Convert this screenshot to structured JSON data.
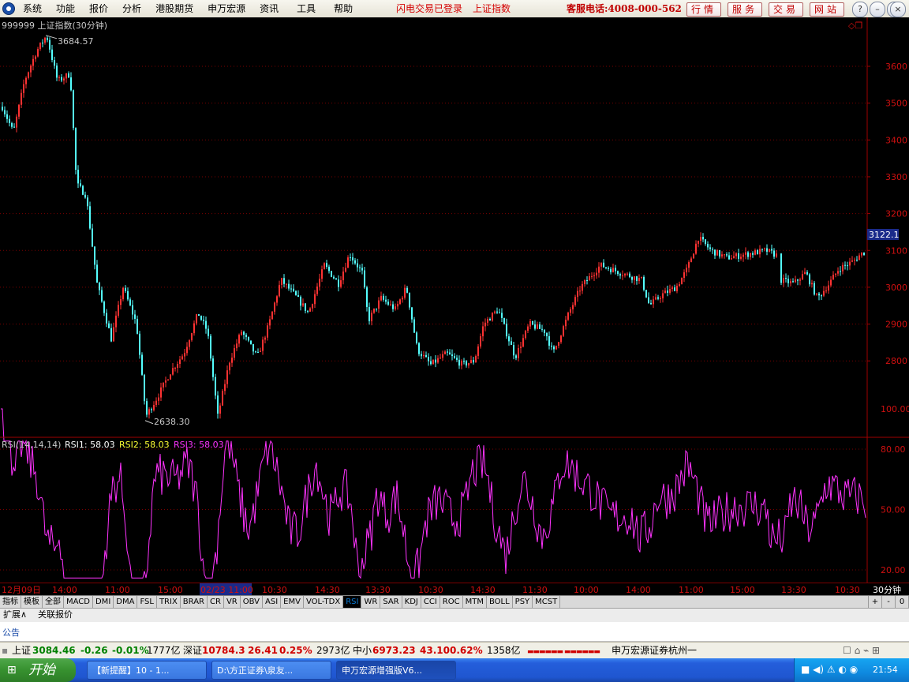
{
  "menu": [
    "系统",
    "功能",
    "报价",
    "分析",
    "港股期货",
    "申万宏源",
    "资讯",
    "工具",
    "帮助"
  ],
  "status": {
    "login": "闪电交易已登录",
    "index": "上证指数"
  },
  "hotline": "客服电话:4008-000-562",
  "nav_buttons": [
    "行情",
    "服务",
    "交易",
    "网站"
  ],
  "chart": {
    "title": "999999 上证指数(30分钟)",
    "price_axis": [
      "3600",
      "3500",
      "3400",
      "3300",
      "3200",
      "3100",
      "3000",
      "2900",
      "2800"
    ],
    "current_price": "3122.1",
    "high_label": "3684.57",
    "low_label": "2638.30",
    "indicator_title": "RSI(14,14,14)",
    "rsi1_label": "RSI1: 58.03",
    "rsi2_label": "RSI2: 58.03",
    "rsi3_label": "RSI3: 58.03",
    "rsi_axis": [
      "100.00",
      "80.00",
      "50.00",
      "20.00"
    ]
  },
  "time_axis": [
    "12月09日",
    "14:00",
    "11:00",
    "15:00",
    "02/23 11:00",
    "10:30",
    "14:30",
    "13:30",
    "10:30",
    "14:30",
    "11:30",
    "10:00",
    "14:00",
    "11:00",
    "15:00",
    "13:30",
    "10:30"
  ],
  "period": "30分钟",
  "indicator_tabs": [
    "指标",
    "模板",
    "全部",
    "MACD",
    "DMI",
    "DMA",
    "FSL",
    "TRIX",
    "BRAR",
    "CR",
    "VR",
    "OBV",
    "ASI",
    "EMV",
    "VOL-TDX",
    "RSI",
    "WR",
    "SAR",
    "KDJ",
    "CCI",
    "ROC",
    "MTM",
    "BOLL",
    "PSY",
    "MCST"
  ],
  "zoom_controls": [
    "+",
    "-",
    "0"
  ],
  "lower_tabs": [
    "扩展∧",
    "关联报价"
  ],
  "notice": "公告",
  "indices": {
    "sh_name": "上证",
    "sh_value": "3084.46",
    "sh_change": "-0.26",
    "sh_pct": "-0.01%",
    "sh_amount": "1777亿",
    "sz_name": "深证",
    "sz_value": "10784.3",
    "sz_change": "26.41",
    "sz_pct": "0.25%",
    "sz_amount": "2973亿",
    "zx_name": "中小",
    "zx_value": "6973.23",
    "zx_change": "43.10",
    "zx_pct": "0.62%",
    "zx_amount": "1358亿",
    "broker": "申万宏源证券杭州一"
  },
  "taskbar": {
    "start": "开始",
    "tasks": [
      "【新提醒】10 - 1...",
      "D:\\方正证券\\泉友...",
      "申万宏源增强版V6..."
    ],
    "clock": "21:54"
  },
  "colors": {
    "up": "#ff3232",
    "down": "#54ffff",
    "rsi": "#ff33ff",
    "axis": "#a00000"
  }
}
